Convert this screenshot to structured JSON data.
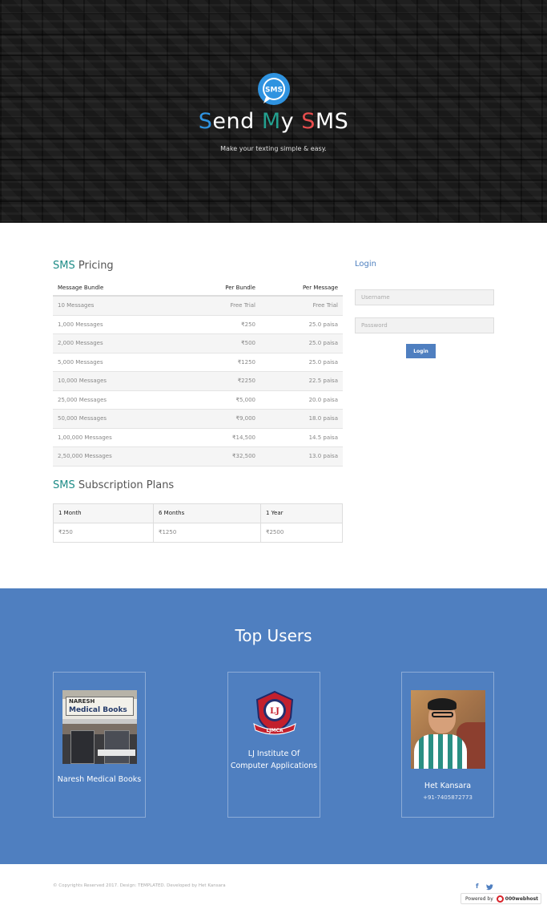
{
  "hero": {
    "logo_text": "SMS",
    "title_parts": [
      "S",
      "end ",
      "M",
      "y ",
      "S",
      "MS"
    ],
    "tagline": "Make your texting simple & easy."
  },
  "colors": {
    "blue": "#4f7fc0",
    "teal": "#1e8c87",
    "red": "#e84d4d",
    "title_blue": "#2f93e0",
    "title_teal": "#23a08f",
    "title_red": "#e84d4d"
  },
  "pricing": {
    "title_a": "SMS",
    "title_b": " Pricing",
    "headers": [
      "Message Bundle",
      "Per Bundle",
      "Per Message"
    ],
    "rows": [
      [
        "10 Messages",
        "Free Trial",
        "Free Trial"
      ],
      [
        "1,000 Messages",
        "₹250",
        "25.0 paisa"
      ],
      [
        "2,000 Messages",
        "₹500",
        "25.0 paisa"
      ],
      [
        "5,000 Messages",
        "₹1250",
        "25.0 paisa"
      ],
      [
        "10,000 Messages",
        "₹2250",
        "22.5 paisa"
      ],
      [
        "25,000 Messages",
        "₹5,000",
        "20.0 paisa"
      ],
      [
        "50,000 Messages",
        "₹9,000",
        "18.0 paisa"
      ],
      [
        "1,00,000 Messages",
        "₹14,500",
        "14.5 paisa"
      ],
      [
        "2,50,000 Messages",
        "₹32,500",
        "13.0 paisa"
      ]
    ]
  },
  "subscription": {
    "title_a": "SMS",
    "title_b": " Subscription Plans",
    "headers": [
      "1 Month",
      "6 Months",
      "1 Year"
    ],
    "values": [
      "₹250",
      "₹1250",
      "₹2500"
    ]
  },
  "login": {
    "title": "Login",
    "username_placeholder": "Username",
    "password_placeholder": "Password",
    "button_label": "Login"
  },
  "top_users": {
    "heading": "Top Users",
    "users": [
      {
        "name": "Naresh Medical Books",
        "phone": "",
        "shop_sign": "NARESH",
        "shop_sign2": "Medical Books"
      },
      {
        "name": "LJ Institute Of Computer Applications",
        "phone": "",
        "emblem_text": "LJMCA",
        "emblem_letters": "LJ"
      },
      {
        "name": "Het Kansara",
        "phone": "+91-7405872773"
      }
    ]
  },
  "footer": {
    "copyright": "© Copyrights Reserved 2017. Design: TEMPLATED. Developed by Het Kansara",
    "facebook_icon": "f",
    "twitter_icon": "🐦",
    "powered_prefix": "Powered by",
    "powered_brand": "000webhost"
  }
}
